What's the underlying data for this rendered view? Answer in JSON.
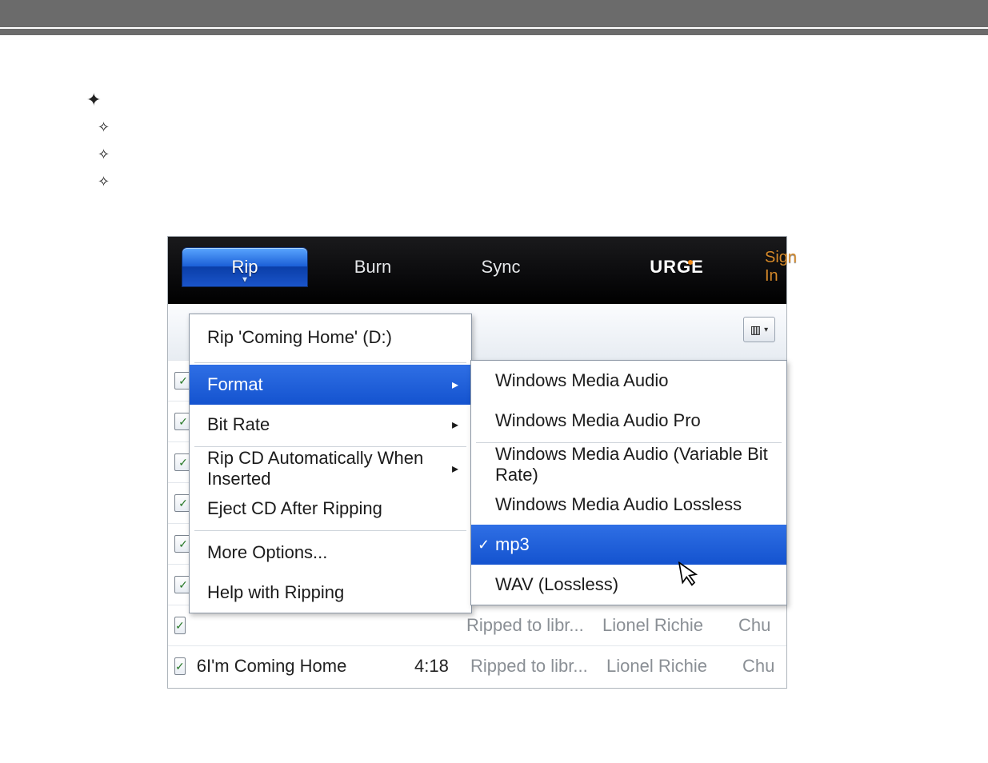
{
  "toolbar": {
    "tabs": [
      {
        "id": "rip",
        "label": "Rip",
        "active": true
      },
      {
        "id": "burn",
        "label": "Burn",
        "active": false
      },
      {
        "id": "sync",
        "label": "Sync",
        "active": false
      }
    ],
    "brand": "URGE",
    "sign_in": "Sign In"
  },
  "rip_menu": {
    "rip_title": "Rip 'Coming Home' (D:)",
    "format": "Format",
    "bitrate": "Bit Rate",
    "auto_rip": "Rip CD Automatically When Inserted",
    "eject": "Eject CD After Ripping",
    "more": "More Options...",
    "help": "Help with Ripping"
  },
  "format_submenu": {
    "options": [
      {
        "label": "Windows Media Audio"
      },
      {
        "label": "Windows Media Audio Pro"
      },
      {
        "label": "Windows Media Audio (Variable Bit Rate)"
      },
      {
        "label": "Windows Media Audio Lossless"
      },
      {
        "label": "mp3",
        "selected": true,
        "highlight": true
      },
      {
        "label": "WAV (Lossless)"
      }
    ]
  },
  "tracks": [
    {
      "num": "",
      "title": "",
      "len": "",
      "status": "Ripped to libr...",
      "artist": "Lionel Richie",
      "album": "Chu"
    },
    {
      "num": "6",
      "title": "I'm Coming Home",
      "len": "4:18",
      "status": "Ripped to libr...",
      "artist": "Lionel Richie",
      "album": "Chu"
    }
  ],
  "colors": {
    "highlight": "#1e5ed8",
    "toolbar_bg": "#0b0b0d",
    "signin": "#d78a2a"
  },
  "icons": {
    "view_toggle": "▥",
    "caret_down": "▾",
    "submenu_arrow": "▸",
    "checkmark": "✓"
  }
}
